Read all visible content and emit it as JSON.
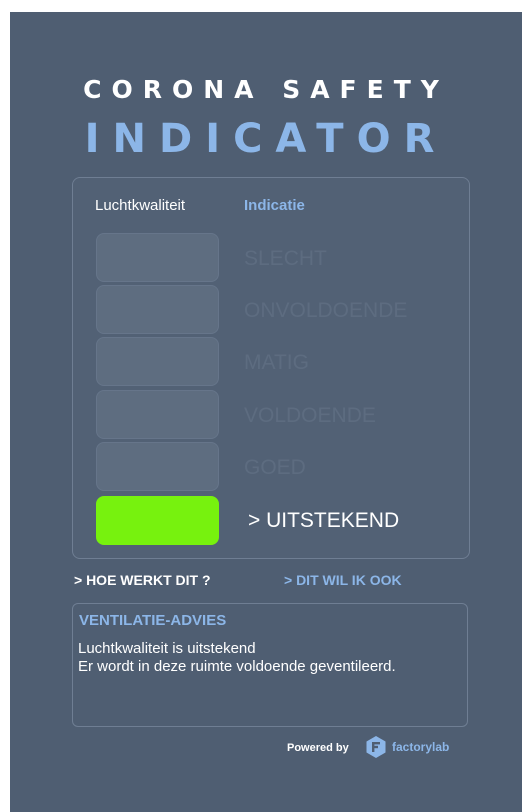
{
  "header": {
    "line1": "CORONA SAFETY",
    "line2": "INDICATOR"
  },
  "panel": {
    "column_left": "Luchtkwaliteit",
    "column_right": "Indicatie",
    "levels": [
      {
        "label": "SLECHT",
        "active": false
      },
      {
        "label": "ONVOLDOENDE",
        "active": false
      },
      {
        "label": "MATIG",
        "active": false
      },
      {
        "label": "VOLDOENDE",
        "active": false
      },
      {
        "label": "GOED",
        "active": false
      },
      {
        "label": "> UITSTEKEND",
        "active": true
      }
    ],
    "active_color": "#77f20e"
  },
  "links": {
    "how": "> HOE WERKT DIT ?",
    "want": "> DIT WIL IK OOK"
  },
  "advice": {
    "title": "VENTILATIE-ADVIES",
    "line1": "Luchtkwaliteit is uitstekend",
    "line2": "Er wordt in deze ruimte voldoende geventileerd."
  },
  "footer": {
    "powered_by": "Powered by",
    "brand": "factorylab",
    "brand_icon": "factorylab-logo-icon"
  },
  "colors": {
    "background": "#4f5e72",
    "accent": "#8cb6e8"
  }
}
